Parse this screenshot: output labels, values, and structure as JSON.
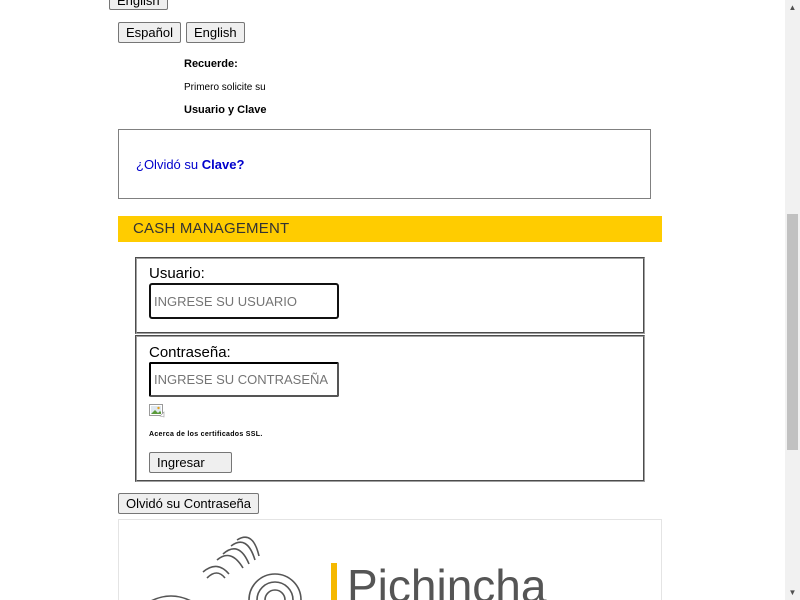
{
  "language": {
    "top_button": "English",
    "spanish_button": "Español",
    "english_button": "English"
  },
  "reminder": {
    "title": "Recuerde:",
    "line1": "Primero solicite su",
    "line2": "Usuario y Clave"
  },
  "forgot_key": {
    "prefix": "¿Olvidó su ",
    "bold": "Clave?"
  },
  "section": {
    "title": "CASH MANAGEMENT",
    "color": "#ffcc00"
  },
  "user": {
    "label": "Usuario:",
    "placeholder": "INGRESE SU USUARIO",
    "value": ""
  },
  "password": {
    "label": "Contraseña:",
    "placeholder": "INGRESE SU CONTRASEÑA",
    "value": ""
  },
  "ssl": {
    "image_icon": "broken-image-icon",
    "note": "Acerca de los certificados SSL."
  },
  "login_button": "Ingresar",
  "forgot_password_button": "Olvidó su Contraseña",
  "logo": {
    "text": "Pichincha",
    "bar_color": "#f5b800"
  },
  "scrollbar": {
    "up_icon": "▲",
    "down_icon": "▼"
  }
}
